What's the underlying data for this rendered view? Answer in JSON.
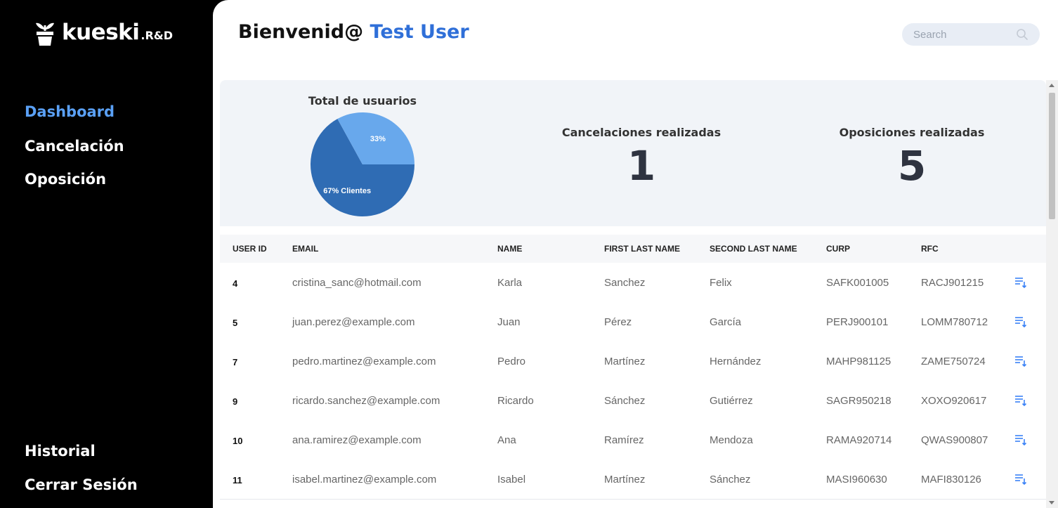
{
  "brand": {
    "name": "kueski",
    "suffix": ".R&D"
  },
  "sidebar": {
    "items": [
      {
        "label": "Dashboard",
        "active": true
      },
      {
        "label": "Cancelación",
        "active": false
      },
      {
        "label": "Oposición",
        "active": false
      }
    ],
    "bottom_items": [
      {
        "label": "Historial"
      },
      {
        "label": "Cerrar Sesión"
      }
    ]
  },
  "header": {
    "greeting": "Bienvenid@",
    "user_name": "Test User"
  },
  "search": {
    "placeholder": "Search"
  },
  "stats": {
    "cancelaciones": {
      "label": "Cancelaciones realizadas",
      "value": "1"
    },
    "oposiciones": {
      "label": "Oposiciones realizadas",
      "value": "5"
    }
  },
  "chart_data": {
    "type": "pie",
    "title": "Total de usuarios",
    "slices": [
      {
        "label": "Clientes",
        "value": 67,
        "display": "67% Clientes",
        "color": "#2f6cb4"
      },
      {
        "label": "",
        "value": 33,
        "display": "33%",
        "color": "#68a8ec"
      }
    ]
  },
  "table": {
    "columns": [
      "USER ID",
      "EMAIL",
      "NAME",
      "FIRST LAST NAME",
      "SECOND LAST NAME",
      "CURP",
      "RFC"
    ],
    "rows": [
      [
        "4",
        "cristina_sanc@hotmail.com",
        "Karla",
        "Sanchez",
        "Felix",
        "SAFK001005",
        "RACJ901215"
      ],
      [
        "5",
        "juan.perez@example.com",
        "Juan",
        "Pérez",
        "García",
        "PERJ900101",
        "LOMM780712"
      ],
      [
        "7",
        "pedro.martinez@example.com",
        "Pedro",
        "Martínez",
        "Hernández",
        "MAHP981125",
        "ZAME750724"
      ],
      [
        "9",
        "ricardo.sanchez@example.com",
        "Ricardo",
        "Sánchez",
        "Gutiérrez",
        "SAGR950218",
        "XOXO920617"
      ],
      [
        "10",
        "ana.ramirez@example.com",
        "Ana",
        "Ramírez",
        "Mendoza",
        "RAMA920714",
        "QWAS900807"
      ],
      [
        "11",
        "isabel.martinez@example.com",
        "Isabel",
        "Martínez",
        "Sánchez",
        "MASI960630",
        "MAFI830126"
      ]
    ]
  },
  "colors": {
    "accent": "#2f6fd8",
    "active_nav": "#5aa0f5",
    "row_icon": "#3b82f6"
  }
}
